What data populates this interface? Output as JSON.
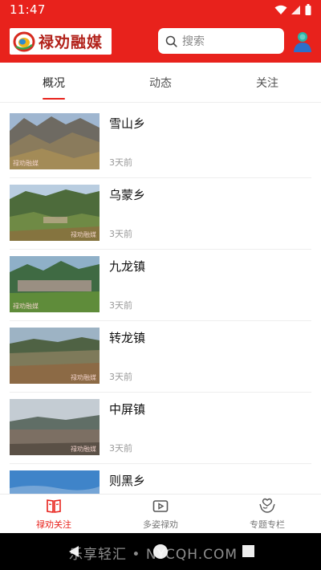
{
  "status_bar": {
    "time": "11:47"
  },
  "header": {
    "logo_text": "禄劝融媒",
    "search_placeholder": "搜索"
  },
  "tabs": [
    {
      "label": "概况",
      "active": true
    },
    {
      "label": "动态",
      "active": false
    },
    {
      "label": "关注",
      "active": false
    }
  ],
  "list": [
    {
      "title": "雪山乡",
      "time": "3天前",
      "watermark": "禄劝融媒"
    },
    {
      "title": "乌蒙乡",
      "time": "3天前",
      "watermark": "禄劝融媒"
    },
    {
      "title": "九龙镇",
      "time": "3天前",
      "watermark": "禄劝融媒"
    },
    {
      "title": "转龙镇",
      "time": "3天前",
      "watermark": "禄劝融媒"
    },
    {
      "title": "中屏镇",
      "time": "3天前",
      "watermark": "禄劝融媒"
    },
    {
      "title": "则黑乡",
      "time": "",
      "watermark": ""
    }
  ],
  "bottom_nav": [
    {
      "label": "禄劝关注",
      "icon": "book-icon",
      "active": true
    },
    {
      "label": "多姿禄劝",
      "icon": "video-icon",
      "active": false
    },
    {
      "label": "专题专栏",
      "icon": "hands-icon",
      "active": false
    }
  ],
  "system_nav_watermark": "乐享轻汇 • NYCQH.COM",
  "colors": {
    "brand": "#e8221c",
    "divider": "#eeeeee",
    "muted_text": "#999999"
  }
}
